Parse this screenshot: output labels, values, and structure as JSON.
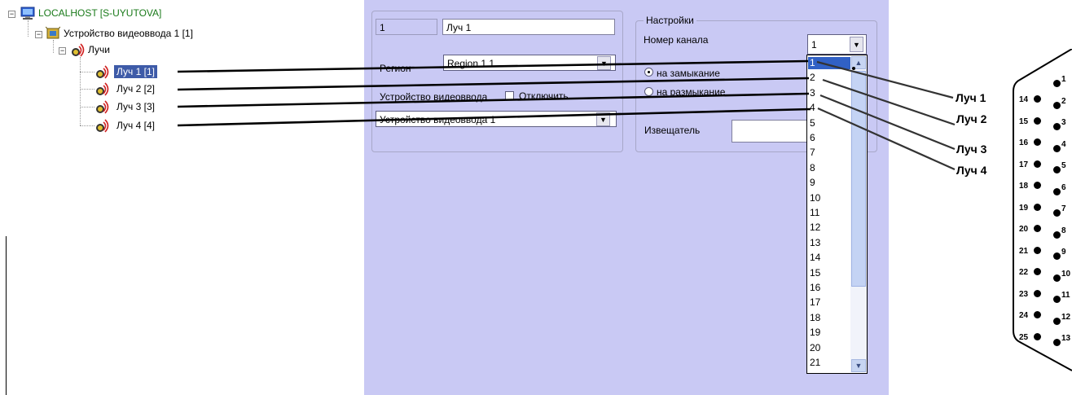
{
  "tree": {
    "root_label": "LOCALHOST [S-UYUTOVA]",
    "device_label": "Устройство видеоввода 1 [1]",
    "loops_label": "Лучи",
    "loops": [
      {
        "label": "Луч 1 [1]",
        "selected": true
      },
      {
        "label": "Луч 2 [2]",
        "selected": false
      },
      {
        "label": "Луч 3 [3]",
        "selected": false
      },
      {
        "label": "Луч 4 [4]",
        "selected": false
      }
    ]
  },
  "object_group": {
    "id_value": "1",
    "name_value": "Луч 1",
    "region_label": "Регион",
    "region_value": "Region 1.1",
    "device_label": "Устройство видеоввода",
    "disable_label": "Отключить",
    "device_value": "Устройство видеоввода 1"
  },
  "settings": {
    "group_title": "Настройки",
    "channel_label": "Номер канала",
    "channel_value": "1",
    "radio_close": "на замыкание",
    "radio_open": "на размыкание",
    "detector_label": "Извещатель",
    "detector_value": "",
    "options": [
      "1",
      "2",
      "3",
      "4",
      "5",
      "6",
      "7",
      "8",
      "9",
      "10",
      "11",
      "12",
      "13",
      "14",
      "15",
      "16",
      "17",
      "18",
      "19",
      "20",
      "21"
    ],
    "selected_option": "1"
  },
  "connector": {
    "loop_labels": [
      "Луч 1",
      "Луч 2",
      "Луч 3",
      "Луч 4"
    ],
    "left_pins": [
      "14",
      "15",
      "16",
      "17",
      "18",
      "19",
      "20",
      "21",
      "22",
      "23",
      "24",
      "25"
    ],
    "right_pins": [
      "1",
      "2",
      "3",
      "4",
      "5",
      "6",
      "7",
      "8",
      "9",
      "10",
      "11",
      "12",
      "13"
    ]
  },
  "colors": {
    "panel_bg": "#c9c9f4",
    "selection": "#3e5ba8",
    "root_text": "#1a7a1a"
  }
}
